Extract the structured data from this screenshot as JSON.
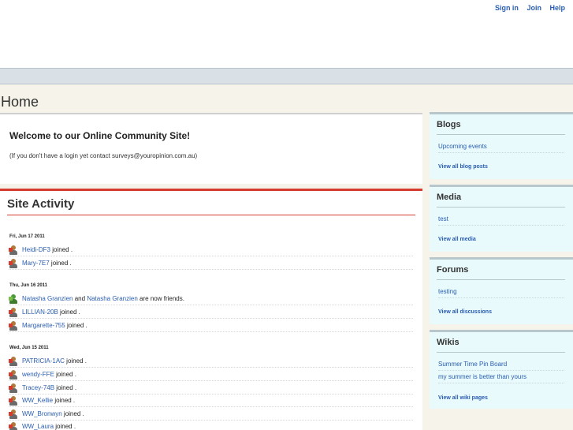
{
  "header": {
    "links": [
      "Sign in",
      "Join",
      "Help"
    ]
  },
  "page": {
    "title": "Home"
  },
  "welcome": {
    "heading": "Welcome to our Online Community Site!",
    "note": "(If you don't have a login yet contact surveys@youropinion.com.au)"
  },
  "activity": {
    "title": "Site Activity",
    "joined": "joined .",
    "friends_and": "and",
    "friends_suffix": "are now friends.",
    "days": [
      {
        "date": "Fri, Jun 17 2011"
      },
      {
        "date": "Thu, Jun 16 2011"
      },
      {
        "date": "Wed, Jun 15 2011"
      }
    ],
    "items": [
      {
        "user": "Heidi-DF3"
      },
      {
        "user": "Mary-7E7"
      },
      {
        "user": "Natasha Granzien",
        "user2": "Natasha Granzien"
      },
      {
        "user": "LILLIAN-20B"
      },
      {
        "user": "Margarette-755"
      },
      {
        "user": "PATRICIA-1AC"
      },
      {
        "user": "wendy-FFE"
      },
      {
        "user": "Tracey-74B"
      },
      {
        "user": "WW_Kellie"
      },
      {
        "user": "WW_Bronwyn"
      },
      {
        "user": "WW_Laura"
      }
    ]
  },
  "sidebar": {
    "blogs": {
      "title": "Blogs",
      "items": [
        "Upcoming events"
      ],
      "view_all": "View all blog posts"
    },
    "media": {
      "title": "Media",
      "items": [
        "test"
      ],
      "view_all": "View all media"
    },
    "forums": {
      "title": "Forums",
      "items": [
        "testing"
      ],
      "view_all": "View all discussions"
    },
    "wikis": {
      "title": "Wikis",
      "items": [
        "Summer Time Pin Board",
        "my summer is better than yours"
      ],
      "view_all": "View all wiki pages"
    }
  },
  "colors": {
    "accent_red": "#d63b2f",
    "link_blue": "#2a5db0",
    "sidebar_bg": "#e8fafc",
    "navbar_bg": "#d9e1e6"
  }
}
